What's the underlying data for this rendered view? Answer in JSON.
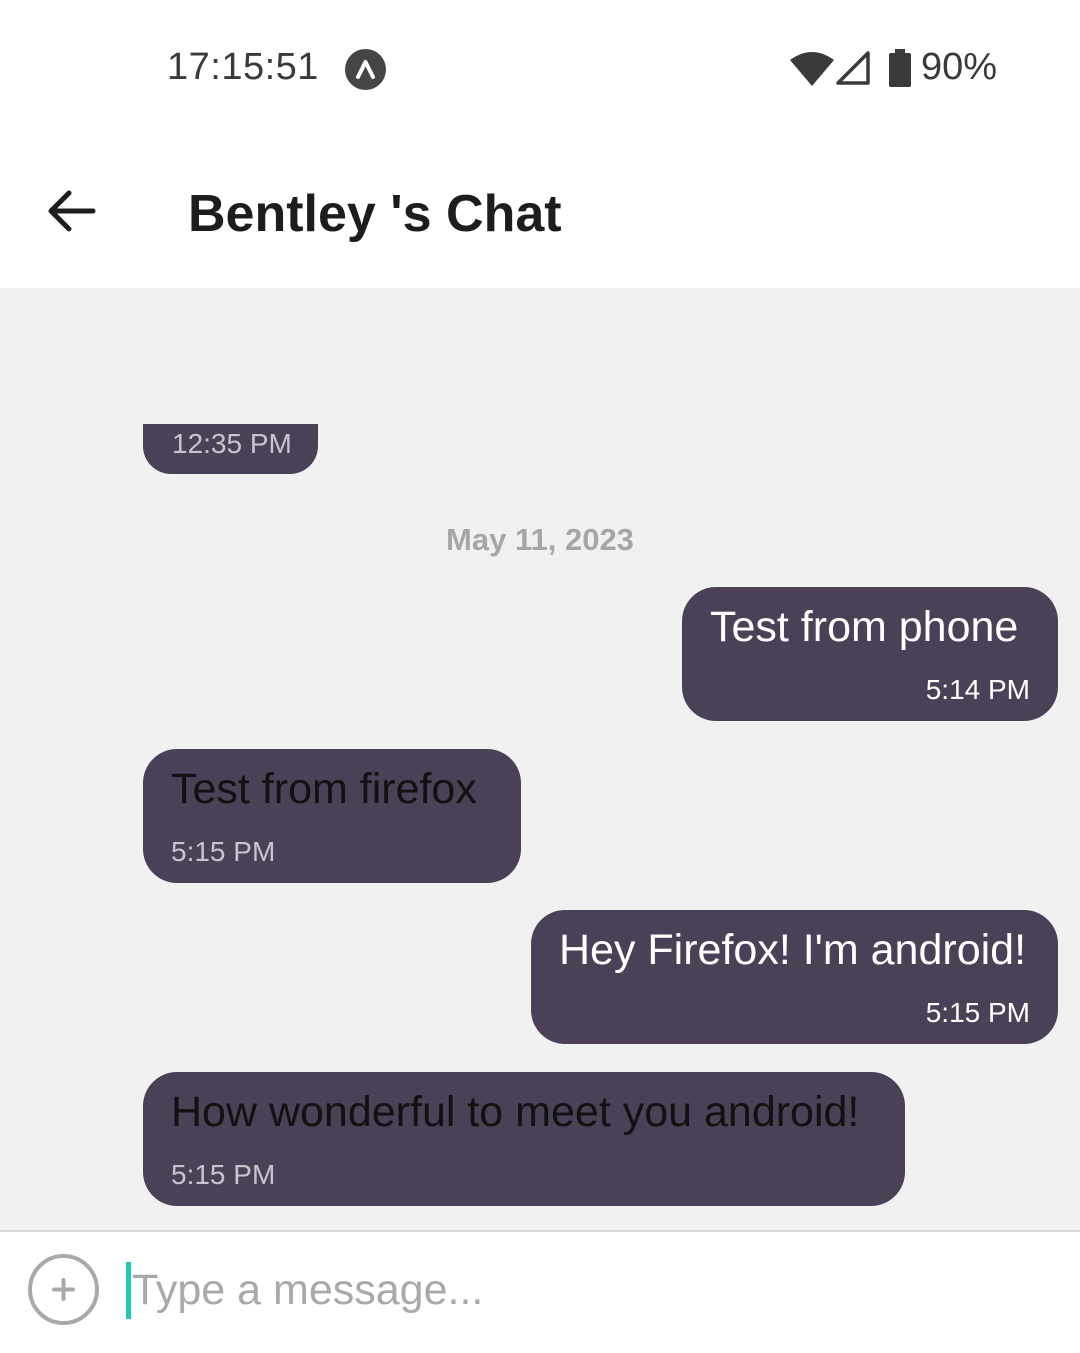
{
  "status_bar": {
    "time": "17:15:51",
    "battery_percent": "90%",
    "icons": [
      "app-notification-icon",
      "wifi-icon",
      "cell-signal-icon",
      "battery-icon"
    ]
  },
  "app_bar": {
    "title": "Bentley 's Chat",
    "back_icon": "arrow-left-icon"
  },
  "messages": {
    "partial_time": "12:35 PM",
    "date_separator": "May 11, 2023",
    "items": [
      {
        "direction": "outgoing",
        "text": "Test from phone",
        "time": "5:14 PM"
      },
      {
        "direction": "incoming",
        "text": "Test from firefox",
        "time": "5:15 PM"
      },
      {
        "direction": "outgoing",
        "text": "Hey Firefox! I'm android!",
        "time": "5:15 PM"
      },
      {
        "direction": "incoming",
        "text": "How wonderful to meet you android!",
        "time": "5:15 PM"
      }
    ]
  },
  "input_bar": {
    "attach_icon": "plus-circle-icon",
    "placeholder": "Type a message..."
  },
  "colors": {
    "bubble": "#4a4157",
    "chat_background": "#f1f1f1",
    "caret": "#1cc8b8"
  }
}
